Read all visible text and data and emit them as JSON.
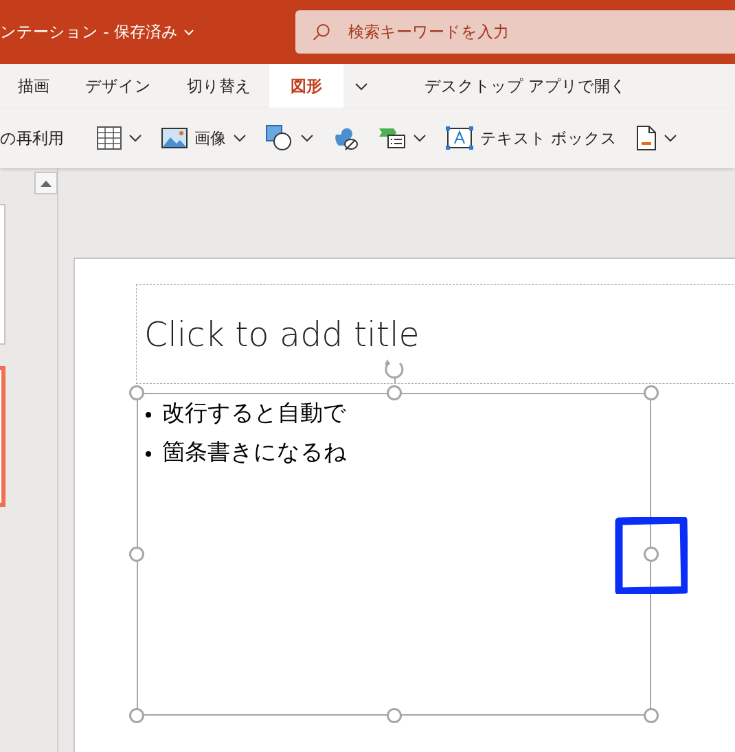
{
  "title_bar": {
    "title": "ンテーション - 保存済み",
    "search": {
      "placeholder": "検索キーワードを入力"
    }
  },
  "tabs": [
    {
      "label": "描画",
      "selected": false
    },
    {
      "label": "デザイン",
      "selected": false
    },
    {
      "label": "切り替え",
      "selected": false
    },
    {
      "label": "図形",
      "selected": true
    }
  ],
  "open_desktop": "デスクトップ アプリで開く",
  "toolbar": [
    {
      "kind": "text",
      "label": "の再利用"
    },
    {
      "kind": "table"
    },
    {
      "kind": "picture",
      "label": "画像"
    },
    {
      "kind": "shapes"
    },
    {
      "kind": "icons"
    },
    {
      "kind": "smartart"
    },
    {
      "kind": "textbox",
      "label": "テキスト ボックス"
    },
    {
      "kind": "form"
    }
  ],
  "thumbnails": [
    {
      "selected": false
    },
    {
      "selected": true
    }
  ],
  "slide": {
    "title_placeholder": "Click to add title",
    "bullets": [
      "改行すると自動で",
      "箇条書きになるね"
    ]
  }
}
